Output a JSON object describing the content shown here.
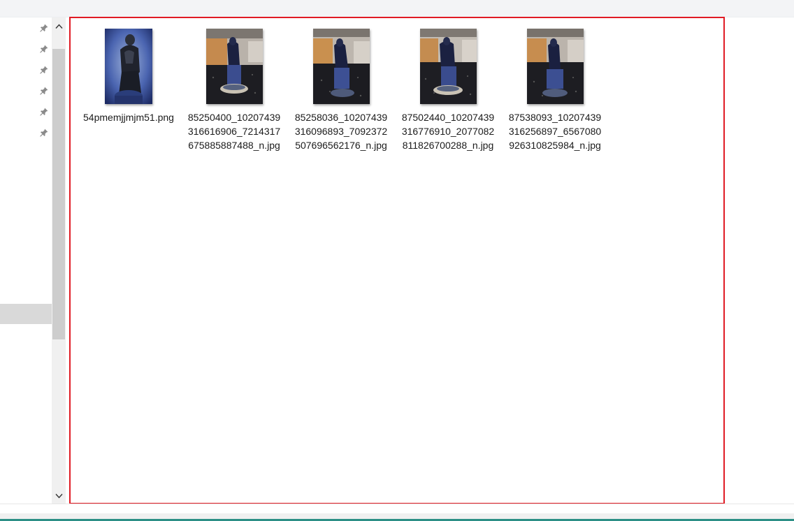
{
  "nav": {
    "pins": [
      "pin-icon",
      "pin-icon",
      "pin-icon",
      "pin-icon",
      "pin-icon",
      "pin-icon"
    ]
  },
  "scrollbar": {
    "up_icon": "chevron-up-icon",
    "down_icon": "chevron-down-icon"
  },
  "files": [
    {
      "name": "54pmemjjmjm51.png"
    },
    {
      "name": "85250400_10207439316616906_7214317675885887488_n.jpg"
    },
    {
      "name": "85258036_10207439316096893_7092372507696562176_n.jpg"
    },
    {
      "name": "87502440_10207439316776910_2077082811826700288_n.jpg"
    },
    {
      "name": "87538093_10207439316256897_6567080926310825984_n.jpg"
    }
  ],
  "colors": {
    "selection_outline": "#e01b24",
    "accent_bar": "#2c8f86"
  }
}
